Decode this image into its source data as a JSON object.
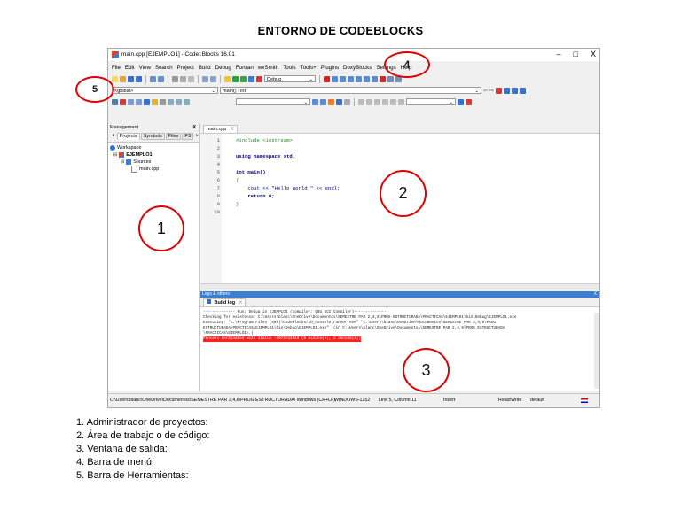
{
  "doc_title": "ENTORNO DE CODEBLOCKS",
  "window": {
    "title": "main.cpp [EJEMPLO1] - Code::Blocks 16.01",
    "controls": [
      "–",
      "□",
      "X"
    ]
  },
  "menu": [
    "File",
    "Edit",
    "View",
    "Search",
    "Project",
    "Build",
    "Debug",
    "Fortran",
    "wxSmith",
    "Tools",
    "Tools+",
    "Plugins",
    "DoxyBlocks",
    "Settings",
    "Help"
  ],
  "toolbar": {
    "build_target": "Debug",
    "scope_select": "<global>",
    "function_select": "main() : int"
  },
  "management": {
    "title": "Management",
    "close": "X",
    "tabs": [
      "Projects",
      "Symbols",
      "Files",
      "FS"
    ],
    "tree": {
      "workspace": "Workspace",
      "project": "EJEMPLO1",
      "folder": "Sources",
      "file": "main.cpp"
    }
  },
  "editor": {
    "tab": "main.cpp",
    "tab_close": "X",
    "lines": [
      {
        "num": "1",
        "text": "#include <iostream>"
      },
      {
        "num": "2",
        "text": ""
      },
      {
        "num": "3",
        "text": "using namespace std;"
      },
      {
        "num": "4",
        "text": ""
      },
      {
        "num": "5",
        "text": "int main()"
      },
      {
        "num": "6",
        "text": "{"
      },
      {
        "num": "7",
        "text": "    cout << \"Hello world!\" << endl;"
      },
      {
        "num": "8",
        "text": "    return 0;"
      },
      {
        "num": "9",
        "text": "}"
      },
      {
        "num": "10",
        "text": ""
      }
    ]
  },
  "logs": {
    "title": "Logs & others",
    "close": "X",
    "tab": "Build log",
    "tab_close": "X",
    "lines": [
      "-------------- Run: Debug in EJEMPLO1 (compiler: GNU GCC Compiler)---------------",
      "",
      "Checking for existence: C:\\Users\\blanc\\OneDrive\\Documentos\\SEMESTRE PAR 2,4,6\\PROG ESTRUCTURADA\\PRACTICAS\\EJEMPLO1\\bin\\Debug\\EJEMPLO1.exe",
      "Executing: \"C:\\Program Files (x86)\\CodeBlocks/cb_console_runner.exe\" \"C:\\Users\\blanc\\OneDrive\\Documentos\\SEMESTRE PAR 2,4,6\\PROG",
      "ESTRUCTURADA\\PRACTICAS\\EJEMPLO1\\bin\\Debug\\EJEMPLO1.exe\"  (in C:\\Users\\blanc\\OneDrive\\Documentos\\SEMESTRE PAR 2,4,6\\PROG ESTRUCTURADA",
      "\\PRACTICAS\\EJEMPLO1\\.)"
    ],
    "error_line": "Process terminated with status -1073741510 (0 minute(s), 2 second(s))"
  },
  "status": {
    "path": "C:\\Users\\blanc\\OneDrive\\Documentos\\SEMESTRE PAR 2,4,6\\PROG ESTRUCTURADA\\ Windows (CR+LF)",
    "encoding": "WINDOWS-1252",
    "position": "Line 5, Column 11",
    "mode": "Insert",
    "access": "Read/Write",
    "profile": "default"
  },
  "callouts": [
    "1",
    "2",
    "3",
    "4",
    "5"
  ],
  "legend": [
    "1.  Administrador de proyectos:",
    "2.  Área de trabajo o de código:",
    "3.  Ventana de salida:",
    "4.  Barra de menú:",
    "5.  Barra de Herramientas:"
  ],
  "colors": {
    "callout": "#e00000",
    "logs_header": "#3c7fd0",
    "error_highlight": "#ff2020"
  }
}
